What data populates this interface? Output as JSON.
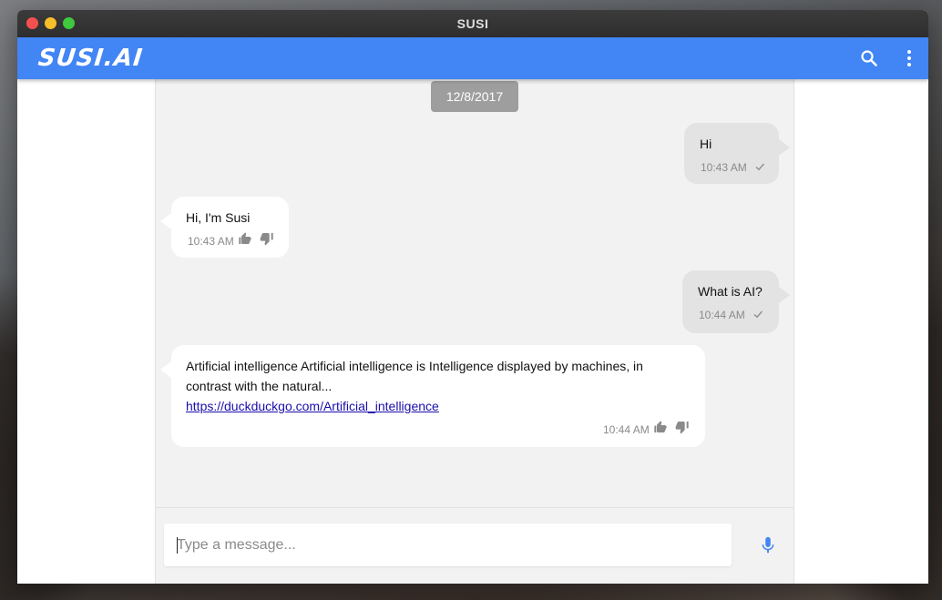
{
  "window": {
    "title": "SUSI"
  },
  "appbar": {
    "logo_text": "SUSI.AI",
    "brand_color": "#4285f4",
    "icons": [
      "search-icon",
      "more-vert-icon"
    ]
  },
  "chat": {
    "date": "12/8/2017",
    "messages": [
      {
        "from": "user",
        "text": "Hi",
        "time": "10:43 AM",
        "status": "check-icon"
      },
      {
        "from": "susi",
        "text": "Hi, I'm Susi",
        "time": "10:43 AM"
      },
      {
        "from": "user",
        "text": "What is AI?",
        "time": "10:44 AM",
        "status": "check-icon"
      },
      {
        "from": "susi",
        "text": "Artificial intelligence Artificial intelligence is Intelligence displayed by machines, in contrast with the natural...",
        "link": "https://duckduckgo.com/Artificial_intelligence",
        "time": "10:44 AM"
      }
    ]
  },
  "composer": {
    "placeholder": "Type a message...",
    "value": "",
    "mic_icon": "mic-icon"
  }
}
